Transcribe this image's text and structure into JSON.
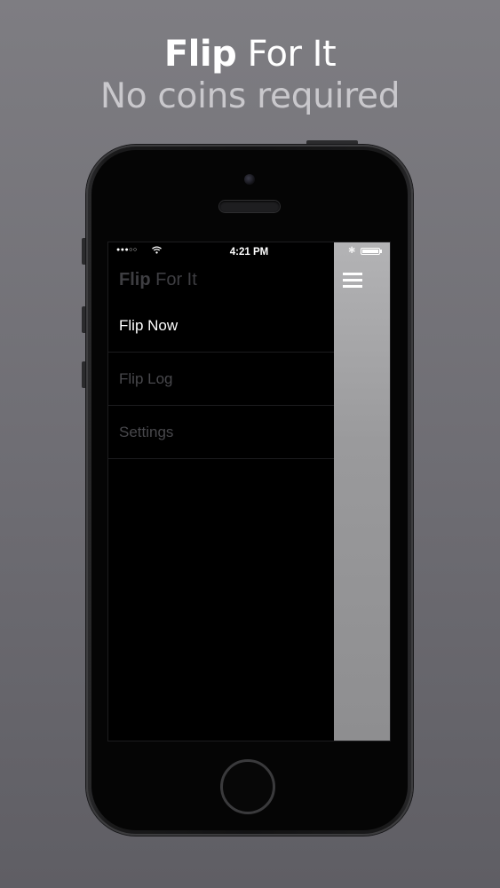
{
  "promo": {
    "headline_bold": "Flip",
    "headline_light": "For It",
    "tagline": "No coins required"
  },
  "status_bar": {
    "time": "4:21 PM",
    "signal_icon": "signal-dots-icon",
    "wifi_icon": "wifi-icon",
    "bluetooth_icon": "bluetooth-icon",
    "battery_icon": "battery-icon",
    "battery_level": 1.0
  },
  "app": {
    "title_bold": "Flip",
    "title_light": "For It",
    "menu_toggle_icon": "hamburger-menu-icon",
    "menu_items": [
      {
        "label": "Flip Now",
        "active": true
      },
      {
        "label": "Flip Log",
        "active": false
      },
      {
        "label": "Settings",
        "active": false
      }
    ]
  },
  "colors": {
    "background": "#6f6e74",
    "menu_background": "#000000",
    "active_item": "#ffffff",
    "inactive_item": "#48484c",
    "content_peek": "#9a9a9c"
  }
}
